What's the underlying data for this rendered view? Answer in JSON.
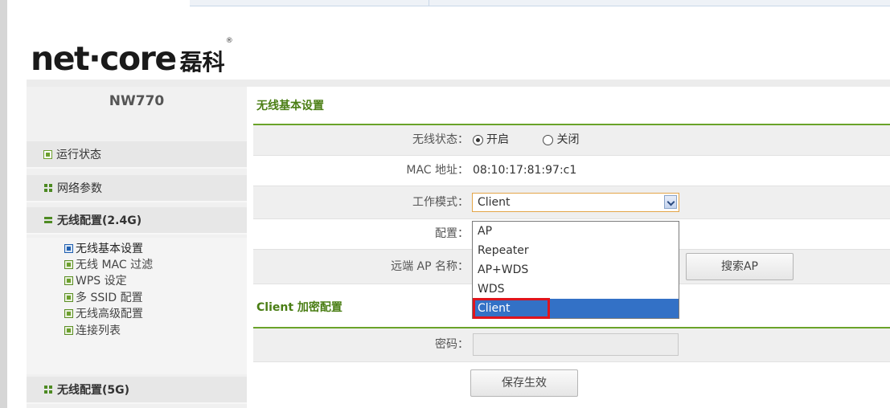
{
  "brand": {
    "logo_text": "net·core",
    "logo_cn": "磊科",
    "registered": "®"
  },
  "sidebar": {
    "model": "NW770",
    "items": [
      {
        "label": "运行状态",
        "icon": "square-icon"
      },
      {
        "label": "网络参数",
        "icon": "grid-icon"
      },
      {
        "label": "无线配置(2.4G)",
        "icon": "bars-icon"
      },
      {
        "label": "无线配置(5G)",
        "icon": "grid-icon"
      }
    ],
    "subitems": [
      {
        "label": "无线基本设置",
        "active": true
      },
      {
        "label": "无线 MAC 过滤"
      },
      {
        "label": "WPS 设定"
      },
      {
        "label": "多 SSID 配置"
      },
      {
        "label": "无线高级配置"
      },
      {
        "label": "连接列表"
      }
    ]
  },
  "main": {
    "section1_title": "无线基本设置",
    "wireless_status": {
      "label": "无线状态：",
      "on": "开启",
      "off": "关闭",
      "selected": "on"
    },
    "mac": {
      "label": "MAC 地址：",
      "value": "08:10:17:81:97:c1"
    },
    "work_mode": {
      "label": "工作模式：",
      "value": "Client",
      "options": [
        "AP",
        "Repeater",
        "AP+WDS",
        "WDS",
        "Client"
      ]
    },
    "config": {
      "label": "配置："
    },
    "remote_ap": {
      "label": "远端 AP 名称：",
      "search_button": "搜索AP"
    },
    "section2_title": "Client 加密配置",
    "password": {
      "label": "密码："
    },
    "save_button": "保存生效"
  },
  "colors": {
    "accent_green": "#6aa329",
    "section_title": "#4a7e14",
    "selected_option": "#3371c6",
    "highlight_box": "#e0141c"
  }
}
